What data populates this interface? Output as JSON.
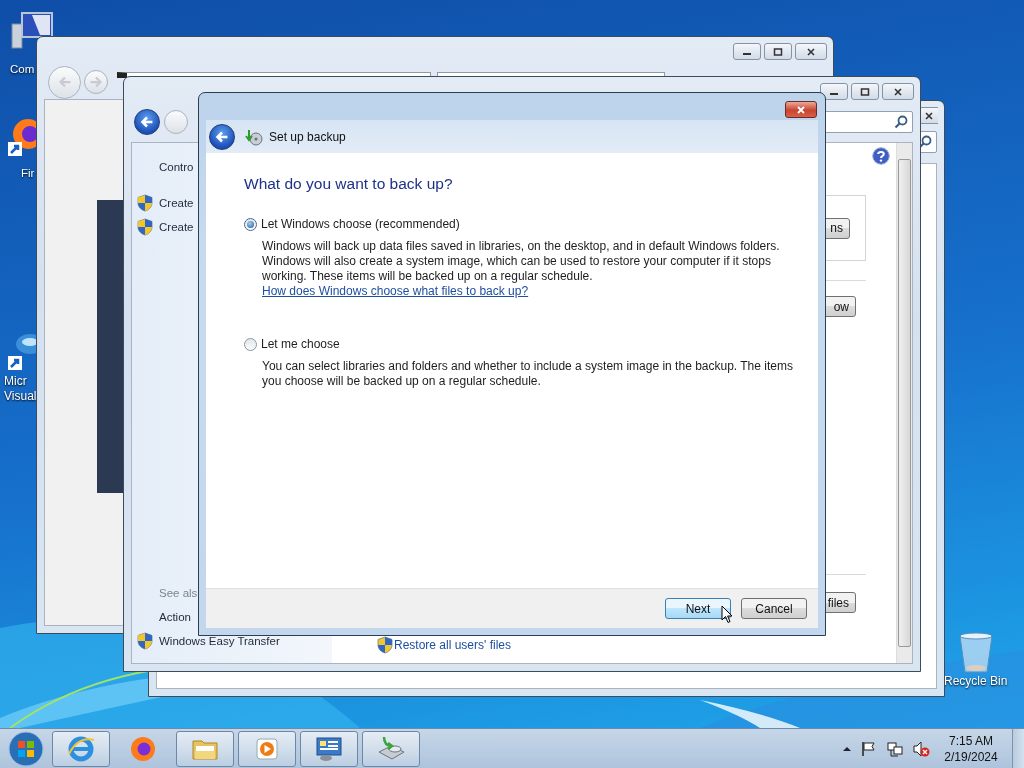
{
  "desktop_icons": [
    {
      "kind": "computer",
      "lines": [
        "Com"
      ]
    },
    {
      "kind": "firefox",
      "lines": [
        "Fir"
      ]
    },
    {
      "kind": "app",
      "lines": [
        "Micr",
        "Visual"
      ]
    },
    {
      "kind": "recycle",
      "lines": [
        "Recycle Bin"
      ]
    }
  ],
  "control_panel": {
    "sidebar": [
      {
        "kind": "link",
        "text": "Contro"
      },
      {
        "kind": "shield",
        "text": "Create"
      },
      {
        "kind": "shield",
        "text": "Create"
      },
      {
        "kind": "heading",
        "text": "See als"
      },
      {
        "kind": "link",
        "text": "Action"
      },
      {
        "kind": "shield",
        "text": "Windows Easy Transfer"
      }
    ],
    "buttons": [
      "ns",
      "ow",
      "files"
    ],
    "links": [
      "Restore all users' files"
    ]
  },
  "dialog": {
    "title": "Set up backup",
    "heading": "What do you want to back up?",
    "options": [
      {
        "label": "Let Windows choose (recommended)",
        "selected": true,
        "description": "Windows will back up data files saved in libraries, on the desktop, and in default Windows folders. Windows will also create a system image, which can be used to restore your computer if it stops working. These items will be backed up on a regular schedule.",
        "link": "How does Windows choose what files to back up?"
      },
      {
        "label": "Let me choose",
        "selected": false,
        "description": "You can select libraries and folders and whether to include a system image in the backup. The items you choose will be backed up on a regular schedule."
      }
    ],
    "buttons": [
      {
        "label": "Next",
        "default": true
      },
      {
        "label": "Cancel",
        "default": false
      }
    ]
  },
  "taskbar": {
    "apps": [
      {
        "kind": "ie",
        "running": true
      },
      {
        "kind": "firefox",
        "running": false
      },
      {
        "kind": "folder",
        "running": true
      },
      {
        "kind": "media",
        "running": true
      },
      {
        "kind": "control",
        "running": true
      },
      {
        "kind": "backup",
        "running": true
      }
    ],
    "speaker_muted": true,
    "time": "7:15 AM",
    "date": "2/19/2024"
  }
}
